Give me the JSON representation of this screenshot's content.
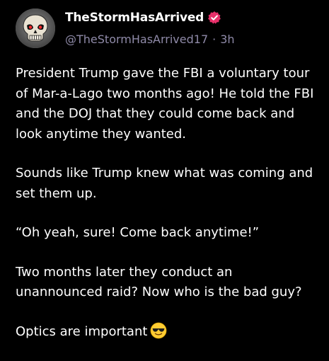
{
  "post": {
    "display_name": "TheStormHasArrived",
    "handle": "@TheStormHasArrived17",
    "separator": "·",
    "time_ago": "3h",
    "paragraphs": [
      "President Trump gave the FBI a voluntary tour of Mar-a-Lago two months ago! He told the FBI and the DOJ that they could come back and look anytime they wanted.",
      "Sounds like Trump knew what was coming and set them up.",
      "“Oh yeah, sure! Come back anytime!”",
      "Two months later they conduct an unannounced raid? Now who is the bad guy?",
      "Optics are important"
    ],
    "icons": {
      "avatar": "punisher-skull-avatar",
      "verified": "verified-badge-icon",
      "emoji": "smiling-face-with-sunglasses-emoji"
    }
  },
  "colors": {
    "background": "#000000",
    "text": "#ffffff",
    "secondary_text": "#8f8aa8",
    "verified_badge": "#e8306a"
  }
}
